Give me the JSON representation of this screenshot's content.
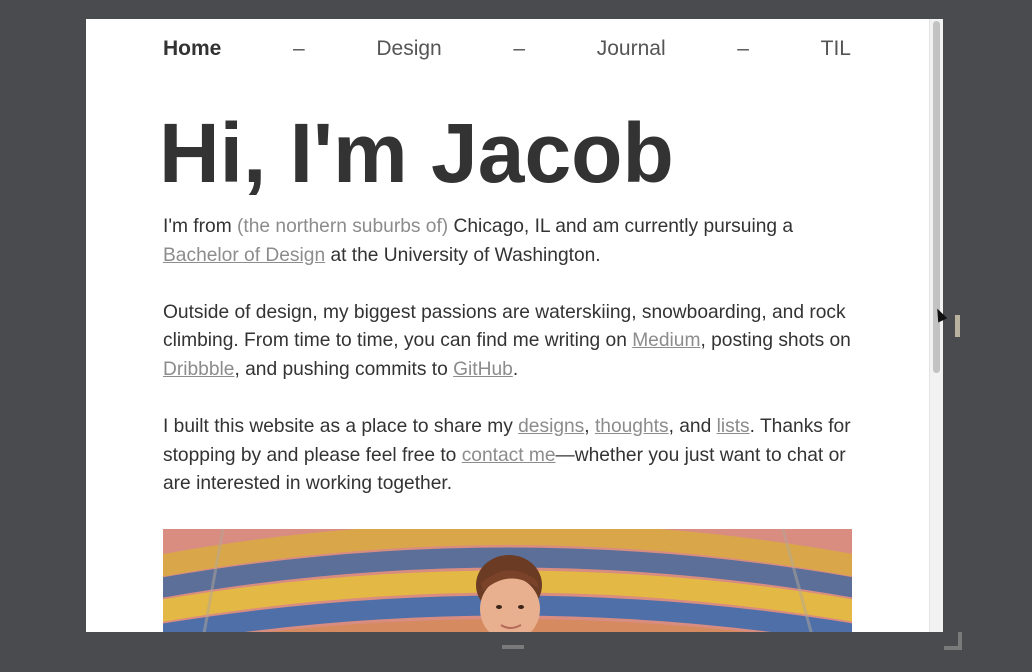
{
  "nav": {
    "items": [
      {
        "label": "Home",
        "active": true
      },
      {
        "label": "Design"
      },
      {
        "label": "Journal"
      },
      {
        "label": "TIL"
      }
    ],
    "separator": "–"
  },
  "hero": {
    "title": "Hi, I'm Jacob"
  },
  "intro": {
    "p1_a": "I'm from ",
    "p1_muted": "(the northern suburbs of)",
    "p1_b": " Chicago, IL and am currently pursuing a ",
    "p1_link": "Bachelor of Design",
    "p1_c": " at the University of Washington.",
    "p2_a": "Outside of design, my biggest passions are waterskiing, snowboarding, and rock climbing. From time to time, you can find me writing on ",
    "p2_link_medium": "Medium",
    "p2_b": ", posting shots on ",
    "p2_link_dribbble": "Dribbble",
    "p2_c": ", and pushing commits to ",
    "p2_link_github": "GitHub",
    "p2_d": ".",
    "p3_a": "I built this website as a place to share my ",
    "p3_link_designs": "designs",
    "p3_b": ", ",
    "p3_link_thoughts": "thoughts",
    "p3_c": ", and ",
    "p3_link_lists": "lists",
    "p3_d": ". Thanks for stopping by and please feel free to ",
    "p3_link_contact": "contact me",
    "p3_e": "—whether you just want to chat or are interested in working together."
  },
  "colors": {
    "page_bg": "#4a4b4e",
    "text": "#333333",
    "link": "#8c8c8c"
  }
}
